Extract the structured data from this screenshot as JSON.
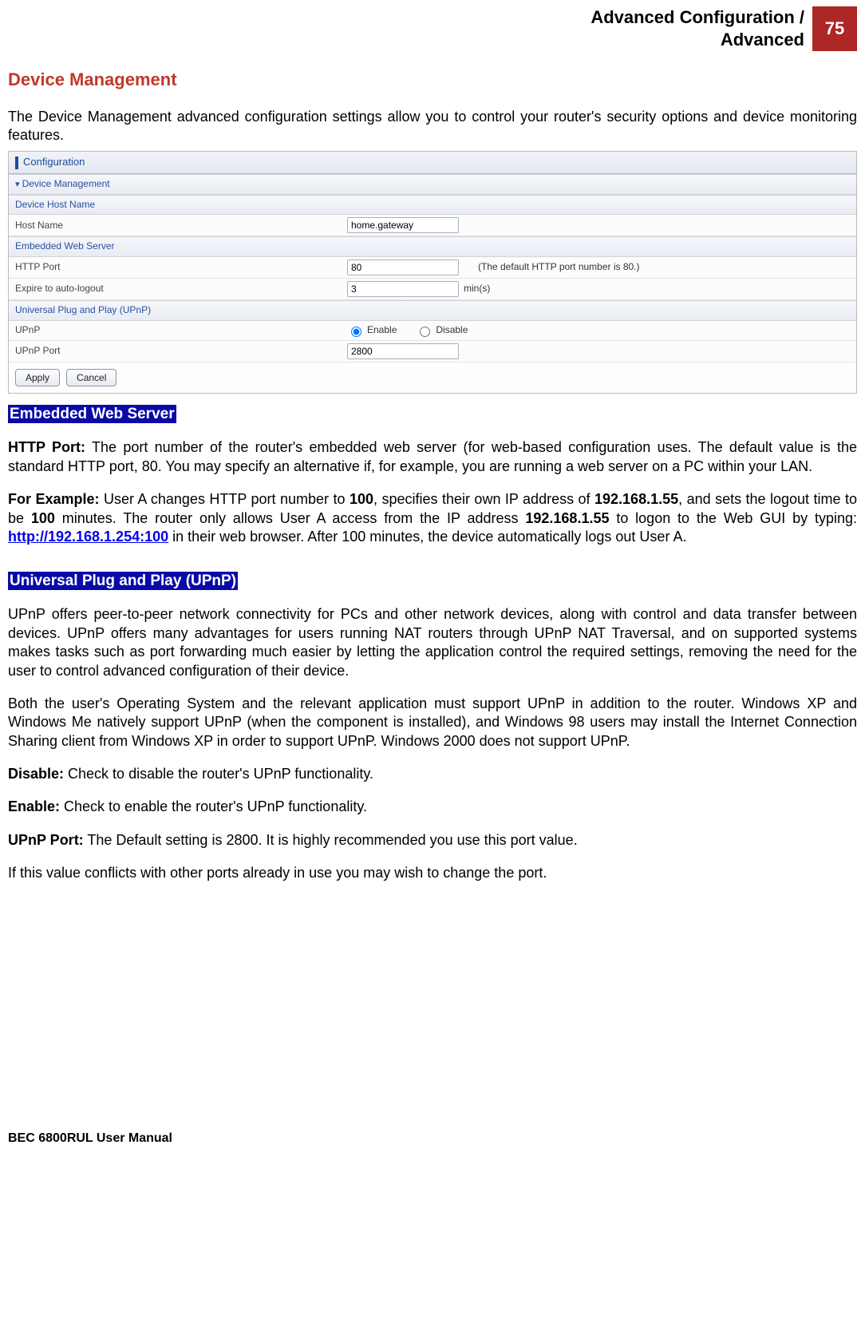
{
  "header": {
    "title_line1": "Advanced Configuration /",
    "title_line2": "Advanced",
    "page_number": "75"
  },
  "section_title": "Device Management",
  "intro": "The Device Management advanced configuration settings allow you to control your router's security options and device monitoring features.",
  "panel": {
    "config_label": "Configuration",
    "section_device_management": "Device Management",
    "section_device_host_name": "Device Host Name",
    "host_name_label": "Host Name",
    "host_name_value": "home.gateway",
    "section_embedded_web_server": "Embedded Web Server",
    "http_port_label": "HTTP Port",
    "http_port_value": "80",
    "http_port_hint": "(The default HTTP port number is 80.)",
    "expire_label": "Expire to auto-logout",
    "expire_value": "3",
    "expire_suffix": "min(s)",
    "section_upnp": "Universal Plug and Play (UPnP)",
    "upnp_label": "UPnP",
    "upnp_enable": "Enable",
    "upnp_disable": "Disable",
    "upnp_port_label": "UPnP Port",
    "upnp_port_value": "2800",
    "apply": "Apply",
    "cancel": "Cancel"
  },
  "heading_ews": "Embedded Web Server",
  "http_port_para_lead": "HTTP Port:",
  "http_port_para": " The port number of the router's embedded web server (for web-based configuration uses. The default value is the standard HTTP port, 80. You may specify an alternative if, for example, you are running a web server on a PC within your LAN.",
  "example_lead": "For Example:",
  "example_text_p1": " User A changes HTTP port number to ",
  "example_100": "100",
  "example_text_p2": ", specifies their own IP address of ",
  "example_ip": "192.168.1.55",
  "example_text_p3": ", and sets the logout time to be ",
  "example_100b": "100",
  "example_text_p4": " minutes.  The router only allows User A access from the IP address ",
  "example_ip2": "192.168.1.55",
  "example_text_p5": " to logon to the Web GUI by typing: ",
  "example_url": "http://192.168.1.254:100",
  "example_text_p6": " in their web browser. After 100 minutes, the device automatically logs out User A.",
  "heading_upnp": "Universal Plug and Play (UPnP)",
  "upnp_para1": "UPnP offers peer-to-peer network connectivity for PCs and other network devices, along with control and data transfer between devices. UPnP offers many advantages for users running NAT routers through UPnP NAT Traversal, and on supported systems makes tasks such as port forwarding much easier by letting the application control the required settings, removing the need for the user to control advanced configuration of their device.",
  "upnp_para2": "Both the user's Operating System and the relevant application must support UPnP in addition to the router. Windows XP and Windows Me natively support UPnP (when the component is installed), and Windows 98 users may install the Internet Connection Sharing client from Windows XP in order to support UPnP. Windows 2000 does not support UPnP.",
  "disable_lead": "Disable:",
  "disable_text": " Check to disable the router's UPnP functionality.",
  "enable_lead": "Enable:",
  "enable_text": " Check to enable the router's UPnP functionality.",
  "upnp_port_lead": "UPnP Port:",
  "upnp_port_text": " The Default setting is 2800. It is highly recommended you use this port value.",
  "conflict_text": "If this value conflicts with other ports already in use you may wish to change the port.",
  "footer": "BEC 6800RUL User Manual"
}
